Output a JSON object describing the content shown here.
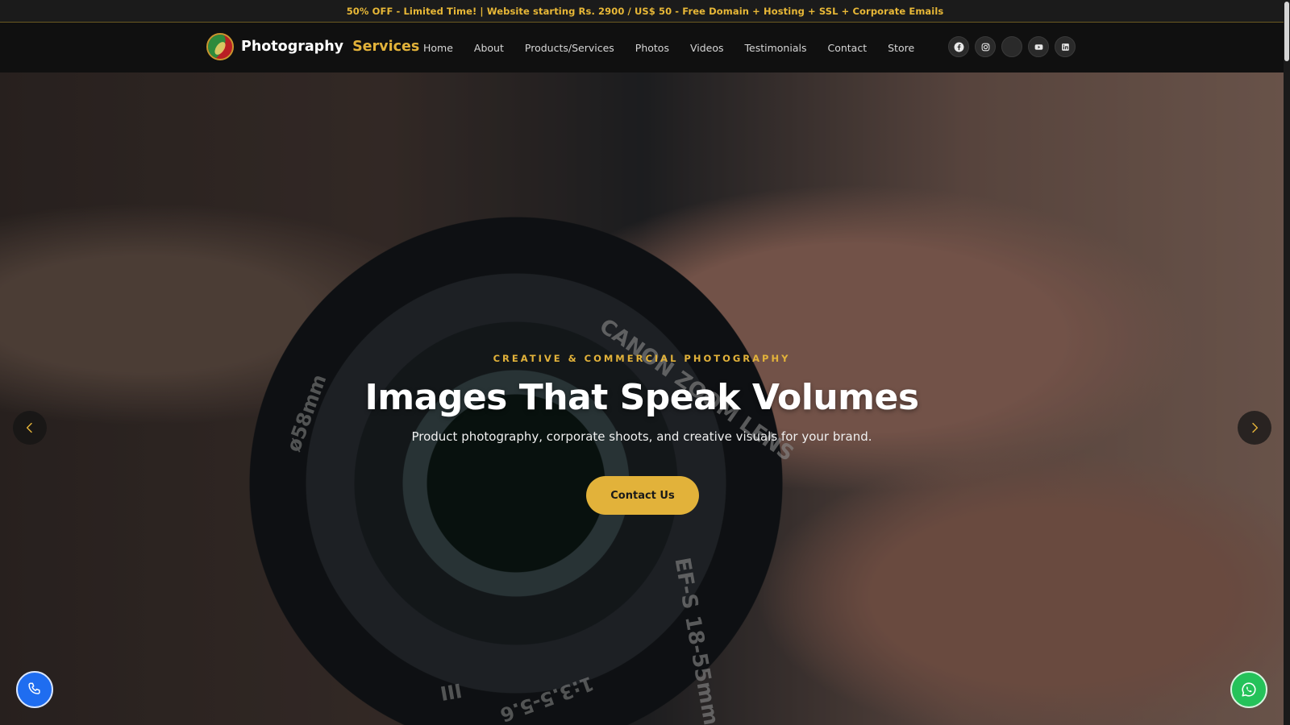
{
  "promo": {
    "text": "50% OFF - Limited Time! | Website starting Rs. 2900 / US$ 50 - Free Domain + Hosting + SSL + Corporate Emails"
  },
  "brand": {
    "name": "Photography",
    "accent": "Services"
  },
  "nav": {
    "items": [
      {
        "label": "Home"
      },
      {
        "label": "About"
      },
      {
        "label": "Products/Services"
      },
      {
        "label": "Photos"
      },
      {
        "label": "Videos"
      },
      {
        "label": "Testimonials"
      },
      {
        "label": "Contact"
      },
      {
        "label": "Store"
      }
    ]
  },
  "social": {
    "icons": [
      "facebook-icon",
      "instagram-icon",
      "blank-social-icon",
      "youtube-icon",
      "linkedin-icon"
    ]
  },
  "hero": {
    "eyebrow": "CREATIVE & COMMERCIAL PHOTOGRAPHY",
    "title": "Images That Speak Volumes",
    "subtitle": "Product photography, corporate shoots, and creative visuals for your brand.",
    "cta_label": "Contact Us",
    "background_image": "camera-lens-hand-photo",
    "lens_text": {
      "brand": "CANON ZOOM LENS",
      "model": "EF-S 18-55mm",
      "aperture": "1:3.5-5.6",
      "mark": "III",
      "diameter": "ø58mm"
    }
  },
  "colors": {
    "accent": "#e2b23a",
    "header_bg": "#101010",
    "phone_button": "#1f6df0",
    "whatsapp_button": "#25c25a"
  },
  "fabs": {
    "phone": "phone-icon",
    "whatsapp": "whatsapp-icon"
  }
}
